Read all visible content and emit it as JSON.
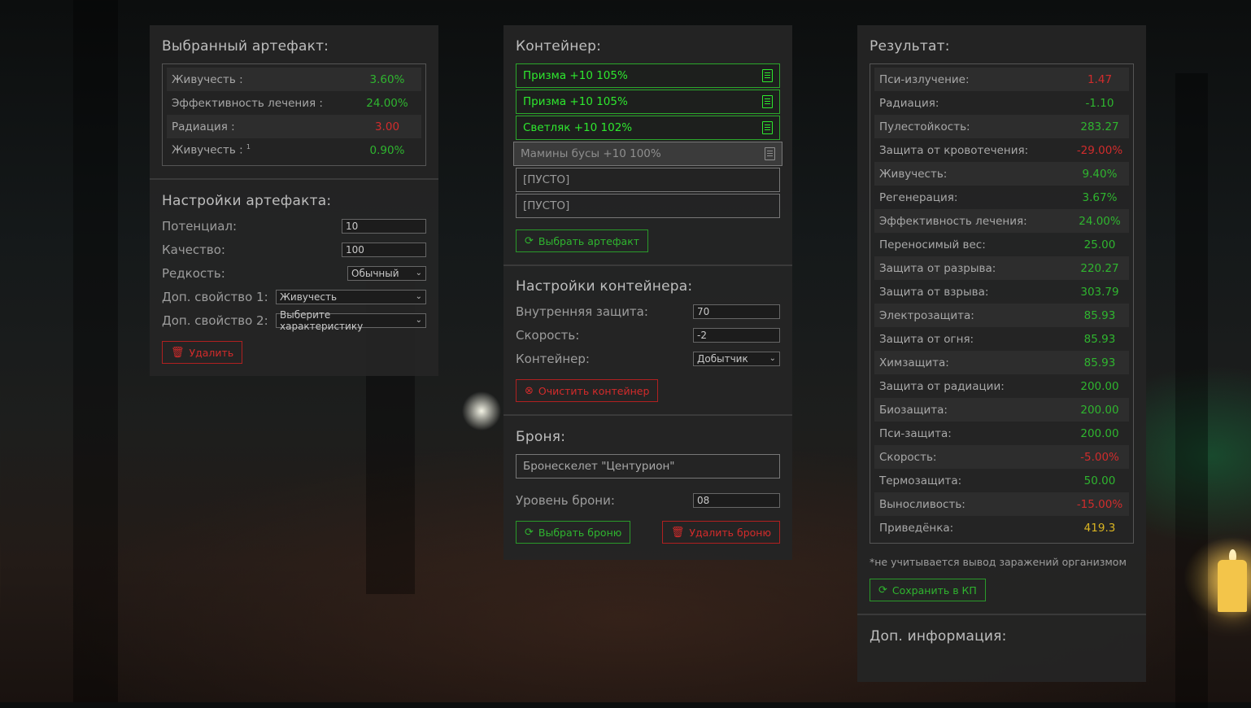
{
  "artifact": {
    "title": "Выбранный артефакт:",
    "stats": [
      {
        "label": "Живучесть :",
        "sup": "",
        "value": "3.60%",
        "color": "green"
      },
      {
        "label": "Эффективность лечения :",
        "sup": "",
        "value": "24.00%",
        "color": "green"
      },
      {
        "label": "Радиация :",
        "sup": "",
        "value": "3.00",
        "color": "red"
      },
      {
        "label": "Живучесть :",
        "sup": "1",
        "value": "0.90%",
        "color": "green"
      }
    ],
    "settings_title": "Настройки артефакта:",
    "potential_label": "Потенциал:",
    "potential_value": "10",
    "quality_label": "Качество:",
    "quality_value": "100",
    "rarity_label": "Редкость:",
    "rarity_value": "Обычный",
    "extra1_label": "Доп. свойство 1:",
    "extra1_value": "Живучесть",
    "extra2_label": "Доп. свойство 2:",
    "extra2_value": "Выберите характеристику",
    "delete_label": "Удалить"
  },
  "container": {
    "title": "Контейнер:",
    "slots": [
      {
        "label": "Призма +10 105%",
        "state": "full"
      },
      {
        "label": "Призма +10 105%",
        "state": "full"
      },
      {
        "label": "Светляк +10 102%",
        "state": "full"
      },
      {
        "label": "Мамины бусы +10 100%",
        "state": "dim"
      },
      {
        "label": "[ПУСТО]",
        "state": "empty"
      },
      {
        "label": "[ПУСТО]",
        "state": "empty"
      }
    ],
    "select_label": "Выбрать артефакт",
    "settings_title": "Настройки контейнера:",
    "inner_label": "Внутренняя защита:",
    "inner_value": "70",
    "speed_label": "Скорость:",
    "speed_value": "-2",
    "type_label": "Контейнер:",
    "type_value": "Добытчик",
    "clear_label": "Очистить контейнер"
  },
  "armor": {
    "title": "Броня:",
    "name": "Бронескелет \"Центурион\"",
    "level_label": "Уровень брони:",
    "level_value": "08",
    "select_label": "Выбрать броню",
    "delete_label": "Удалить броню"
  },
  "result": {
    "title": "Результат:",
    "stats": [
      {
        "label": "Пси-излучение:",
        "value": "1.47",
        "color": "red"
      },
      {
        "label": "Радиация:",
        "value": "-1.10",
        "color": "green"
      },
      {
        "label": "Пулестойкость:",
        "value": "283.27",
        "color": "green"
      },
      {
        "label": "Защита от кровотечения:",
        "value": "-29.00%",
        "color": "red"
      },
      {
        "label": "Живучесть:",
        "value": "9.40%",
        "color": "green"
      },
      {
        "label": "Регенерация:",
        "value": "3.67%",
        "color": "green"
      },
      {
        "label": "Эффективность лечения:",
        "value": "24.00%",
        "color": "green"
      },
      {
        "label": "Переносимый вес:",
        "value": "25.00",
        "color": "green"
      },
      {
        "label": "Защита от разрыва:",
        "value": "220.27",
        "color": "green"
      },
      {
        "label": "Защита от взрыва:",
        "value": "303.79",
        "color": "green"
      },
      {
        "label": "Электрозащита:",
        "value": "85.93",
        "color": "green"
      },
      {
        "label": "Защита от огня:",
        "value": "85.93",
        "color": "green"
      },
      {
        "label": "Химзащита:",
        "value": "85.93",
        "color": "green"
      },
      {
        "label": "Защита от радиации:",
        "value": "200.00",
        "color": "green"
      },
      {
        "label": "Биозащита:",
        "value": "200.00",
        "color": "green"
      },
      {
        "label": "Пси-защита:",
        "value": "200.00",
        "color": "green"
      },
      {
        "label": "Скорость:",
        "value": "-5.00%",
        "color": "red"
      },
      {
        "label": "Термозащита:",
        "value": "50.00",
        "color": "green"
      },
      {
        "label": "Выносливость:",
        "value": "-15.00%",
        "color": "red"
      },
      {
        "label": "Приведёнка:",
        "value": "419.3",
        "color": "yellow"
      }
    ],
    "note": "*не учитывается вывод заражений организмом",
    "save_label": "Сохранить в КП",
    "extra_title": "Доп. информация:"
  },
  "colors": {
    "green": "#2fb52f",
    "red": "#d12c2c",
    "yellow": "#d9b422",
    "panel": "#242424"
  }
}
